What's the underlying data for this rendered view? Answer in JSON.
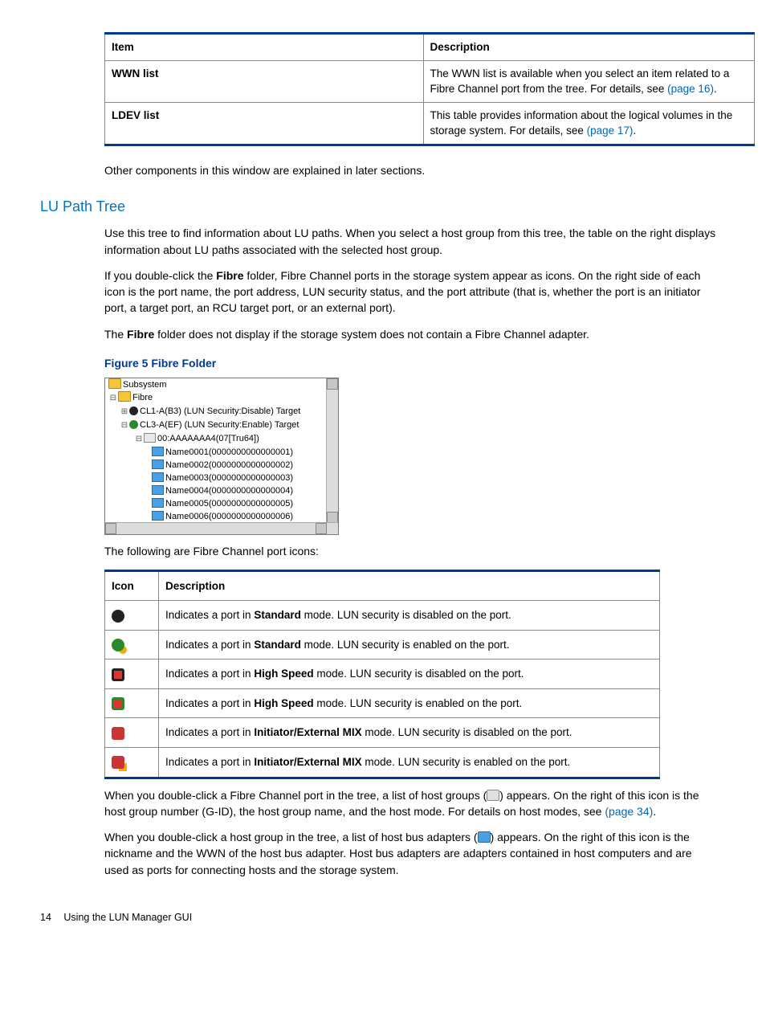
{
  "table1": {
    "headers": [
      "Item",
      "Description"
    ],
    "rows": [
      {
        "item": "WWN list",
        "desc_pre": "The WWN list is available when you select an item related to a Fibre Channel port from the tree. For details, see ",
        "link": "(page 16)",
        "desc_post": "."
      },
      {
        "item": "LDEV list",
        "desc_pre": "This table provides information about the logical volumes in the storage system. For details, see ",
        "link": "(page 17)",
        "desc_post": "."
      }
    ]
  },
  "p_other": "Other components in this window are explained in later sections.",
  "h_lu": "LU Path Tree",
  "p_lu1": "Use this tree to find information about LU paths. When you select a host group from this tree, the table on the right displays information about LU paths associated with the selected host group.",
  "p_lu2a": "If you double-click the ",
  "p_lu2_bold": "Fibre",
  "p_lu2b": " folder, Fibre Channel ports in the storage system appear as icons. On the right side of each icon is the port name, the port address, LUN security status, and the port attribute (that is, whether the port is an initiator port, a target port, an RCU target port, or an external port).",
  "p_lu3a": "The ",
  "p_lu3_bold": "Fibre",
  "p_lu3b": " folder does not display if the storage system does not contain a Fibre Channel adapter.",
  "figcap": "Figure 5 Fibre Folder",
  "tree": {
    "root": "Subsystem",
    "fibre": "Fibre",
    "port1": "CL1-A(B3) (LUN Security:Disable) Target",
    "port2": "CL3-A(EF) (LUN Security:Enable) Target",
    "hg": "00:AAAAAAA4(07[Tru64])",
    "hbas": [
      "Name0001(0000000000000001)",
      "Name0002(0000000000000002)",
      "Name0003(0000000000000003)",
      "Name0004(0000000000000004)",
      "Name0005(0000000000000005)",
      "Name0006(0000000000000006)"
    ]
  },
  "p_icons_intro": "The following are Fibre Channel port icons:",
  "icon_table": {
    "headers": [
      "Icon",
      "Description"
    ],
    "rows": [
      {
        "pre": "Indicates a port in ",
        "b": "Standard",
        "post": " mode. LUN security is disabled on the port.",
        "cls": "std-d"
      },
      {
        "pre": "Indicates a port in ",
        "b": "Standard",
        "post": " mode. LUN security is enabled on the port.",
        "cls": "std-e"
      },
      {
        "pre": "Indicates a port in ",
        "b": "High Speed",
        "post": " mode. LUN security is disabled on the port.",
        "cls": "hs-d"
      },
      {
        "pre": "Indicates a port in ",
        "b": "High Speed",
        "post": " mode. LUN security is enabled on the port.",
        "cls": "hs-e"
      },
      {
        "pre": "Indicates a port in ",
        "b": "Initiator/External MIX",
        "post": " mode. LUN security is disabled on the port.",
        "cls": "mix-d"
      },
      {
        "pre": "Indicates a port in ",
        "b": "Initiator/External MIX",
        "post": " mode. LUN security is enabled on the port.",
        "cls": "mix-e"
      }
    ]
  },
  "p_hg1": "When you double-click a Fibre Channel port in the tree, a list of host groups (",
  "p_hg2": ") appears. On the right of this icon is the host group number (G-ID), the host group name, and the host mode. For details on host modes, see ",
  "p_hg_link": "(page 34)",
  "p_hg3": ".",
  "p_hba1": "When you double-click a host group in the tree, a list of host bus adapters (",
  "p_hba2": ") appears. On the right of this icon is the nickname and the WWN of the host bus adapter. Host bus adapters are adapters contained in host computers and are used as ports for connecting hosts and the storage system.",
  "footer": {
    "page": "14",
    "title": "Using the LUN Manager GUI"
  }
}
